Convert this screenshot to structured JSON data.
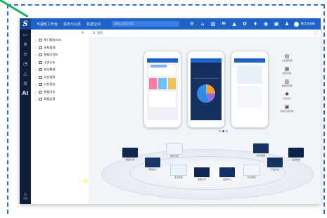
{
  "app": {
    "logo_text": "S",
    "top_tabs": [
      "可视化工作台",
      "报表与仪表",
      "数据空间"
    ],
    "search_placeholder": "请输入搜索内容",
    "top_icons": [
      "settings-icon",
      "home-icon",
      "chart-icon",
      "ai-icon",
      "lock-icon",
      "palette-icon",
      "bell-icon",
      "theme-icon",
      "layout-icon",
      "user-icon"
    ],
    "ai_label": "AI",
    "user_name": "数字化创新"
  },
  "rail": {
    "icons": [
      "monitor-icon",
      "network-icon",
      "layers-icon",
      "database-icon",
      "warning-icon",
      "settings-icon"
    ],
    "ai_label": "AI",
    "bottom_label": "系统"
  },
  "tree": {
    "items": [
      "数门服务meo",
      "系统管理",
      "数据可视化",
      "业务分析",
      "移动数据",
      "综合报表",
      "分析报告",
      "数据分析",
      "数据运营"
    ]
  },
  "tabbar": {
    "home_label": "首页"
  },
  "right_icons": [
    {
      "glyph": "▤",
      "label": "仪表盘管理"
    },
    {
      "glyph": "▦",
      "label": "报表管理"
    },
    {
      "glyph": "▥",
      "label": "数据源管理"
    },
    {
      "glyph": "✱",
      "label": "分析设计"
    },
    {
      "glyph": "▣",
      "label": "移动应用管理"
    }
  ],
  "thumbnails": [
    "数据大屏",
    "项目统计",
    "业务看板",
    "数据分析",
    "监控中心",
    "综合展示",
    "产品分析",
    "运营数据",
    "趋势分析",
    "实时监控"
  ],
  "colors": {
    "topbar": "#1e62c8",
    "rail": "#0e1e3a",
    "frame_dash": "#2f6fd6",
    "green_slash": "#1fae5a"
  }
}
